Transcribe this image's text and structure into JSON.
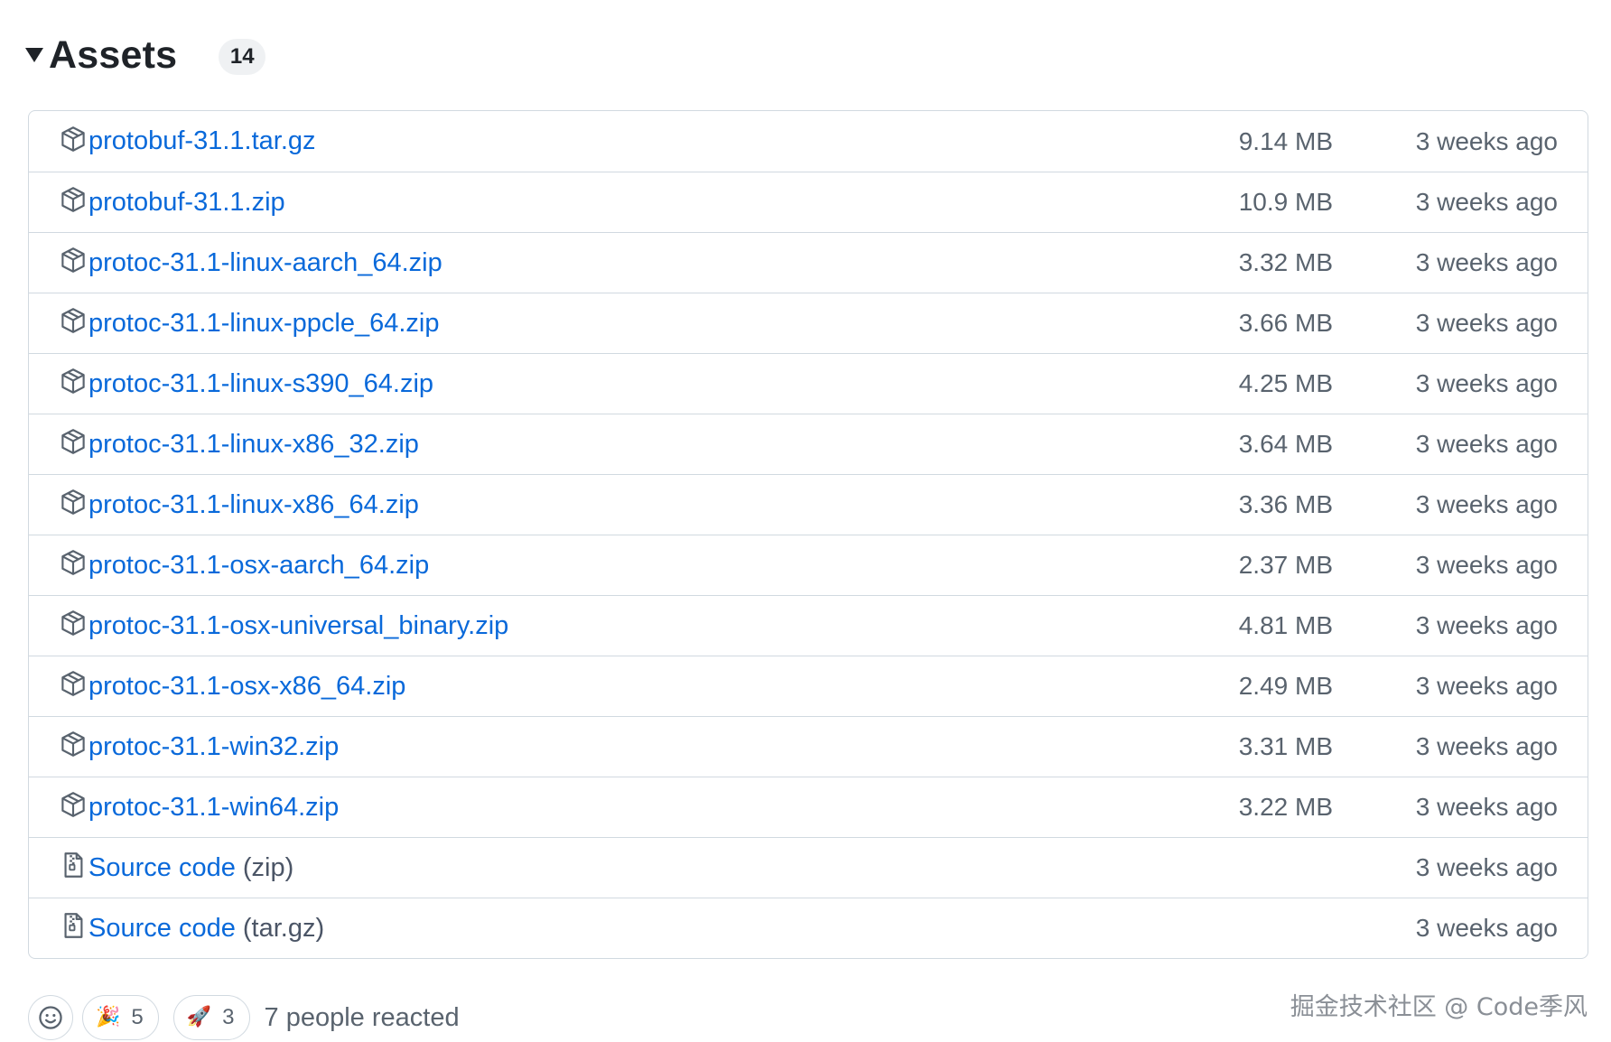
{
  "assets": {
    "title": "Assets",
    "count": "14",
    "items": [
      {
        "name": "protobuf-31.1.tar.gz",
        "suffix": "",
        "size": "9.14 MB",
        "date": "3 weeks ago",
        "icon": "package-icon"
      },
      {
        "name": "protobuf-31.1.zip",
        "suffix": "",
        "size": "10.9 MB",
        "date": "3 weeks ago",
        "icon": "package-icon"
      },
      {
        "name": "protoc-31.1-linux-aarch_64.zip",
        "suffix": "",
        "size": "3.32 MB",
        "date": "3 weeks ago",
        "icon": "package-icon"
      },
      {
        "name": "protoc-31.1-linux-ppcle_64.zip",
        "suffix": "",
        "size": "3.66 MB",
        "date": "3 weeks ago",
        "icon": "package-icon"
      },
      {
        "name": "protoc-31.1-linux-s390_64.zip",
        "suffix": "",
        "size": "4.25 MB",
        "date": "3 weeks ago",
        "icon": "package-icon"
      },
      {
        "name": "protoc-31.1-linux-x86_32.zip",
        "suffix": "",
        "size": "3.64 MB",
        "date": "3 weeks ago",
        "icon": "package-icon"
      },
      {
        "name": "protoc-31.1-linux-x86_64.zip",
        "suffix": "",
        "size": "3.36 MB",
        "date": "3 weeks ago",
        "icon": "package-icon"
      },
      {
        "name": "protoc-31.1-osx-aarch_64.zip",
        "suffix": "",
        "size": "2.37 MB",
        "date": "3 weeks ago",
        "icon": "package-icon"
      },
      {
        "name": "protoc-31.1-osx-universal_binary.zip",
        "suffix": "",
        "size": "4.81 MB",
        "date": "3 weeks ago",
        "icon": "package-icon"
      },
      {
        "name": "protoc-31.1-osx-x86_64.zip",
        "suffix": "",
        "size": "2.49 MB",
        "date": "3 weeks ago",
        "icon": "package-icon"
      },
      {
        "name": "protoc-31.1-win32.zip",
        "suffix": "",
        "size": "3.31 MB",
        "date": "3 weeks ago",
        "icon": "package-icon"
      },
      {
        "name": "protoc-31.1-win64.zip",
        "suffix": "",
        "size": "3.22 MB",
        "date": "3 weeks ago",
        "icon": "package-icon"
      },
      {
        "name": "Source code",
        "suffix": "(zip)",
        "size": "",
        "date": "3 weeks ago",
        "icon": "file-zip-icon"
      },
      {
        "name": "Source code",
        "suffix": "(tar.gz)",
        "size": "",
        "date": "3 weeks ago",
        "icon": "file-zip-icon"
      }
    ]
  },
  "reactions": {
    "items": [
      {
        "emoji": "🎉",
        "count": "5",
        "name": "hooray"
      },
      {
        "emoji": "🚀",
        "count": "3",
        "name": "rocket"
      }
    ],
    "summary": "7 people reacted"
  },
  "watermark": "掘金技术社区 @ Code季风",
  "colors": {
    "link": "#0969da",
    "muted": "#59636e",
    "border": "#d1d9e0",
    "badge_bg": "#eff1f3"
  }
}
